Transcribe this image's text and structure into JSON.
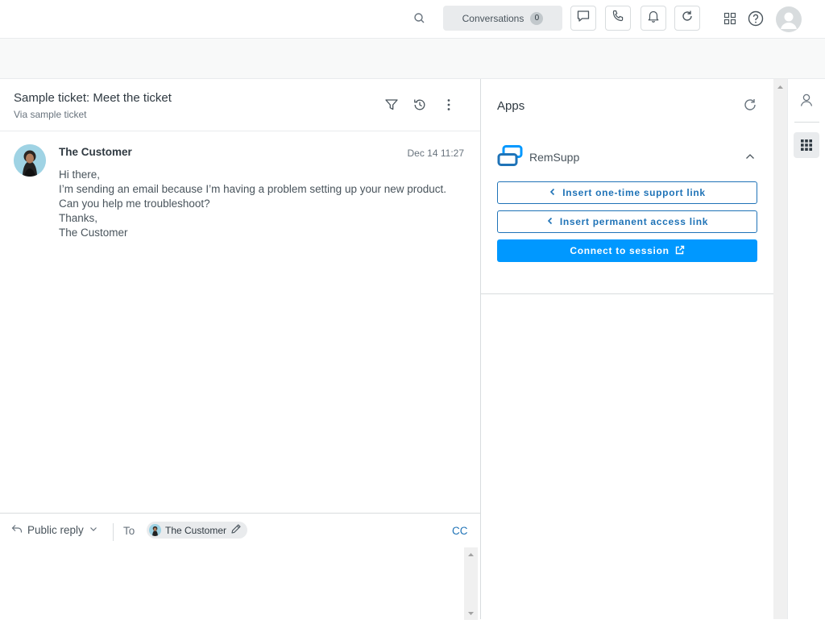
{
  "header": {
    "conversations_label": "Conversations",
    "conversations_count": "0",
    "icons": [
      "search-icon",
      "chat-icon",
      "phone-icon",
      "bell-icon",
      "refresh-icon",
      "products-grid-icon",
      "help-icon",
      "user-avatar"
    ]
  },
  "ticket": {
    "title": "Sample ticket: Meet the ticket",
    "subtitle": "Via sample ticket",
    "actions": [
      "filter-icon",
      "history-icon",
      "more-icon"
    ]
  },
  "message": {
    "author": "The Customer",
    "time": "Dec 14 11:27",
    "lines": [
      "Hi there,",
      "I’m sending an email because I’m having a problem setting up your new product.",
      "Can you help me troubleshoot?",
      "Thanks,",
      "The Customer"
    ]
  },
  "reply": {
    "type_label": "Public reply",
    "to_label": "To",
    "recipient": "The Customer",
    "cc_label": "CC"
  },
  "apps": {
    "title": "Apps",
    "app_name": "RemSupp",
    "buttons": {
      "one_time": "Insert one-time support link",
      "permanent": "Insert permanent access link",
      "connect": "Connect to session"
    },
    "accent_color": "#0098ff",
    "link_color": "#1f73b7"
  },
  "rail": {
    "icons": [
      "user-icon",
      "apps-grid-icon"
    ]
  }
}
